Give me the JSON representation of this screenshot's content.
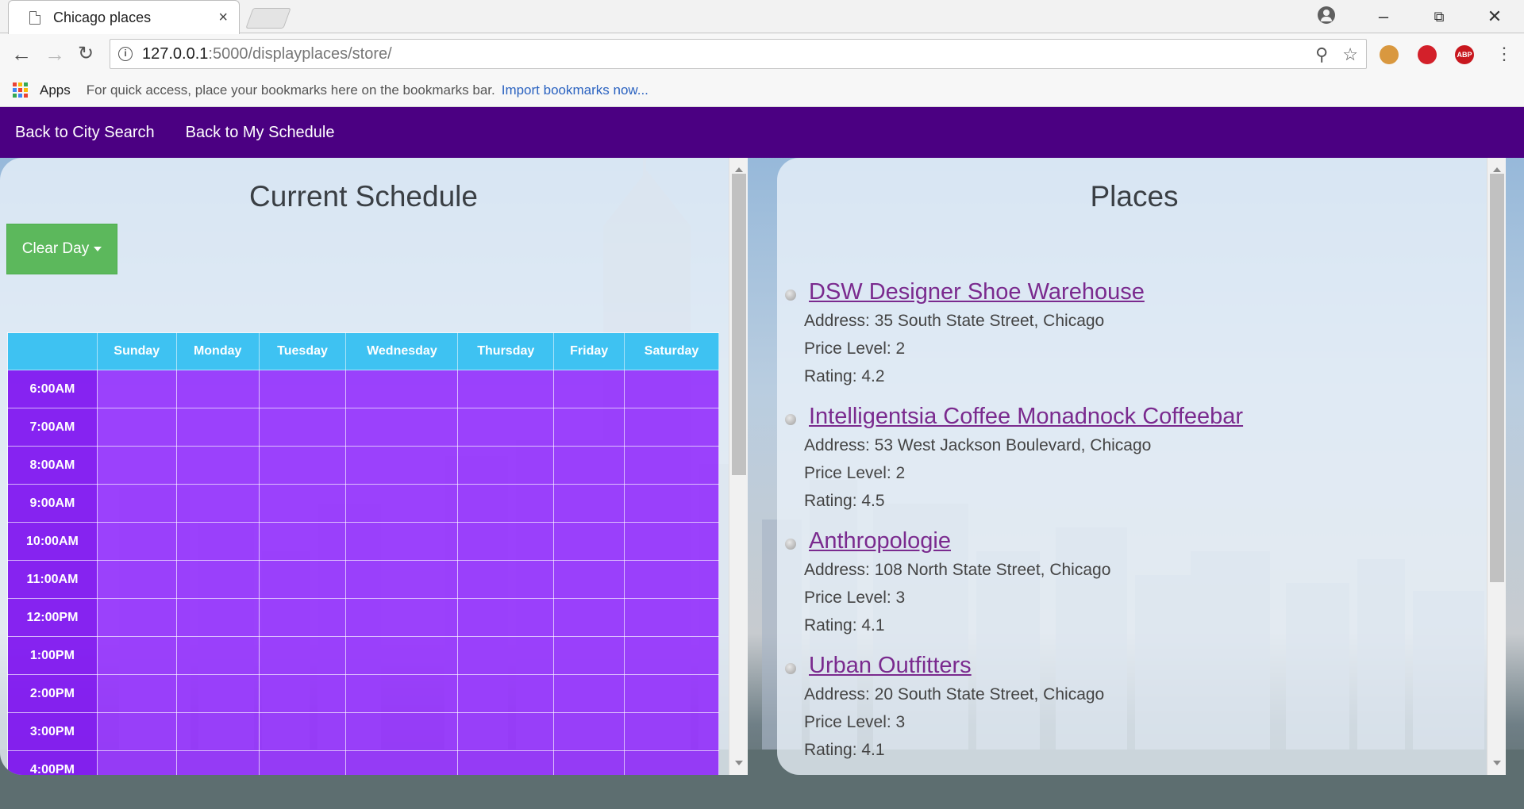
{
  "browser": {
    "tab_title": "Chicago places",
    "tab_close": "×",
    "url_host": "127.0.0.1",
    "url_path": ":5000/displayplaces/store/",
    "bookmarks": {
      "apps_label": "Apps",
      "hint": "For quick access, place your bookmarks here on the bookmarks bar.",
      "import_link": "Import bookmarks now..."
    }
  },
  "nav": {
    "back_city": "Back to City Search",
    "back_schedule": "Back to My Schedule"
  },
  "schedule": {
    "title": "Current Schedule",
    "clear_button": "Clear Day",
    "days": [
      "Sunday",
      "Monday",
      "Tuesday",
      "Wednesday",
      "Thursday",
      "Friday",
      "Saturday"
    ],
    "times": [
      "6:00AM",
      "7:00AM",
      "8:00AM",
      "9:00AM",
      "10:00AM",
      "11:00AM",
      "12:00PM",
      "1:00PM",
      "2:00PM",
      "3:00PM",
      "4:00PM"
    ]
  },
  "places": {
    "title": "Places",
    "items": [
      {
        "name": "DSW Designer Shoe Warehouse",
        "address": "Address: 35 South State Street, Chicago",
        "price": "Price Level: 2",
        "rating": "Rating: 4.2"
      },
      {
        "name": "Intelligentsia Coffee Monadnock Coffeebar",
        "address": "Address: 53 West Jackson Boulevard, Chicago",
        "price": "Price Level: 2",
        "rating": "Rating: 4.5"
      },
      {
        "name": "Anthropologie",
        "address": "Address: 108 North State Street, Chicago",
        "price": "Price Level: 3",
        "rating": "Rating: 4.1"
      },
      {
        "name": "Urban Outfitters",
        "address": "Address: 20 South State Street, Chicago",
        "price": "Price Level: 3",
        "rating": "Rating: 4.1"
      }
    ]
  },
  "colors": {
    "navbar": "#4b0082",
    "table_header": "#3ec2f2",
    "table_cell": "#8000ff",
    "clear_button": "#5cb85c",
    "place_link": "#7a2a8e"
  }
}
